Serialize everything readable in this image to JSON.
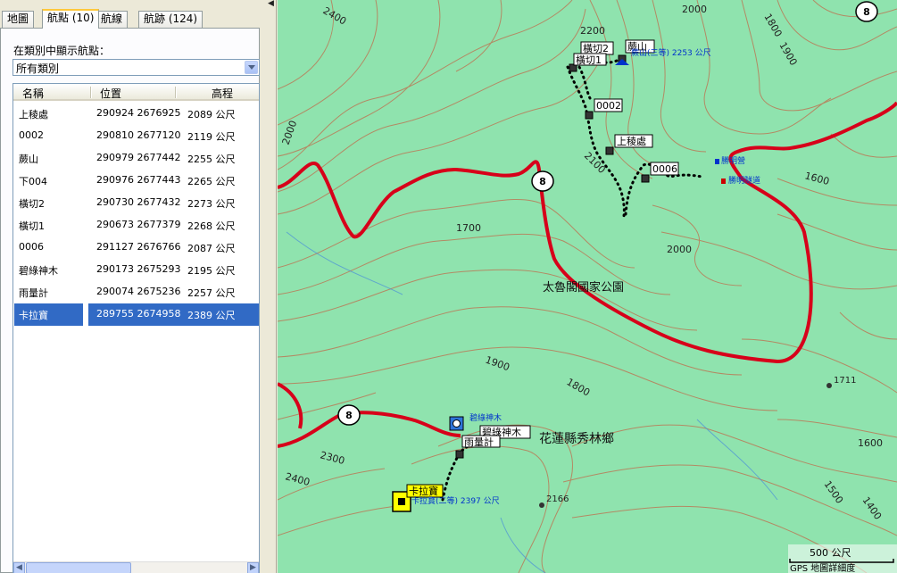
{
  "tabs": [
    {
      "label": "地圖"
    },
    {
      "label": "航點 (10)"
    },
    {
      "label": "航線"
    },
    {
      "label": "航跡 (124)"
    }
  ],
  "filter": {
    "label": "在類別中顯示航點：",
    "value": "所有類別"
  },
  "list": {
    "headers": {
      "name": "名稱",
      "position": "位置",
      "elevation": "高程"
    },
    "rows": [
      {
        "name": "上稜處",
        "position": "290924 2676925",
        "elevation": "2089 公尺"
      },
      {
        "name": "0002",
        "position": "290810 2677120",
        "elevation": "2119 公尺"
      },
      {
        "name": "蕨山",
        "position": "290979 2677442",
        "elevation": "2255 公尺"
      },
      {
        "name": "下004",
        "position": "290976 2677443",
        "elevation": "2265 公尺"
      },
      {
        "name": "橫切2",
        "position": "290730 2677432",
        "elevation": "2273 公尺"
      },
      {
        "name": "橫切1",
        "position": "290673 2677379",
        "elevation": "2268 公尺"
      },
      {
        "name": "0006",
        "position": "291127 2676766",
        "elevation": "2087 公尺"
      },
      {
        "name": "碧綠神木",
        "position": "290173 2675293",
        "elevation": "2195 公尺"
      },
      {
        "name": "雨量計",
        "position": "290074 2675236",
        "elevation": "2257 公尺"
      },
      {
        "name": "卡拉寶",
        "position": "289755 2674958",
        "elevation": "2389 公尺"
      }
    ],
    "selected_index": 9
  },
  "splitter": {
    "glyph": "◀"
  },
  "map": {
    "colors": {
      "terrain": "#8fe3ae",
      "contour": "#b38a64",
      "road": "#d7001a",
      "track": "#000000",
      "water": "#4a8fd8"
    },
    "contour_labels": [
      "2400",
      "2000",
      "1800",
      "1900",
      "2000",
      "1600",
      "2200",
      "2100",
      "1700",
      "2000",
      "1900",
      "1800",
      "1600",
      "2300",
      "2400",
      "1500",
      "1400"
    ],
    "road_shields": [
      "8",
      "8",
      "8"
    ],
    "place_labels": {
      "park": "太魯閣國家公園",
      "township": "花蓮縣秀林鄉"
    },
    "waypoint_labels": {
      "yokogiri2": "橫切2",
      "fernmtn": "蕨山",
      "yokogiri1": "橫切1",
      "p0002": "0002",
      "shangleng": "上稜處",
      "p0006": "0006",
      "bilu": "碧綠神木",
      "rain": "雨量計",
      "kalabao": "卡拉寶"
    },
    "poi_labels": {
      "fernmtn_tri": "蕨山(三等) 2253 公尺",
      "shengming_ying": "勝明營",
      "shengming_trail": "勝明隧道",
      "bilu_poi": "碧綠神木",
      "kalabao_tri": "卡拉寶(二等) 2397 公尺",
      "peak2166": "2166",
      "peak1711": "1711"
    },
    "scale": {
      "distance": "500 公尺",
      "detail": "GPS 地圖詳細度"
    }
  }
}
